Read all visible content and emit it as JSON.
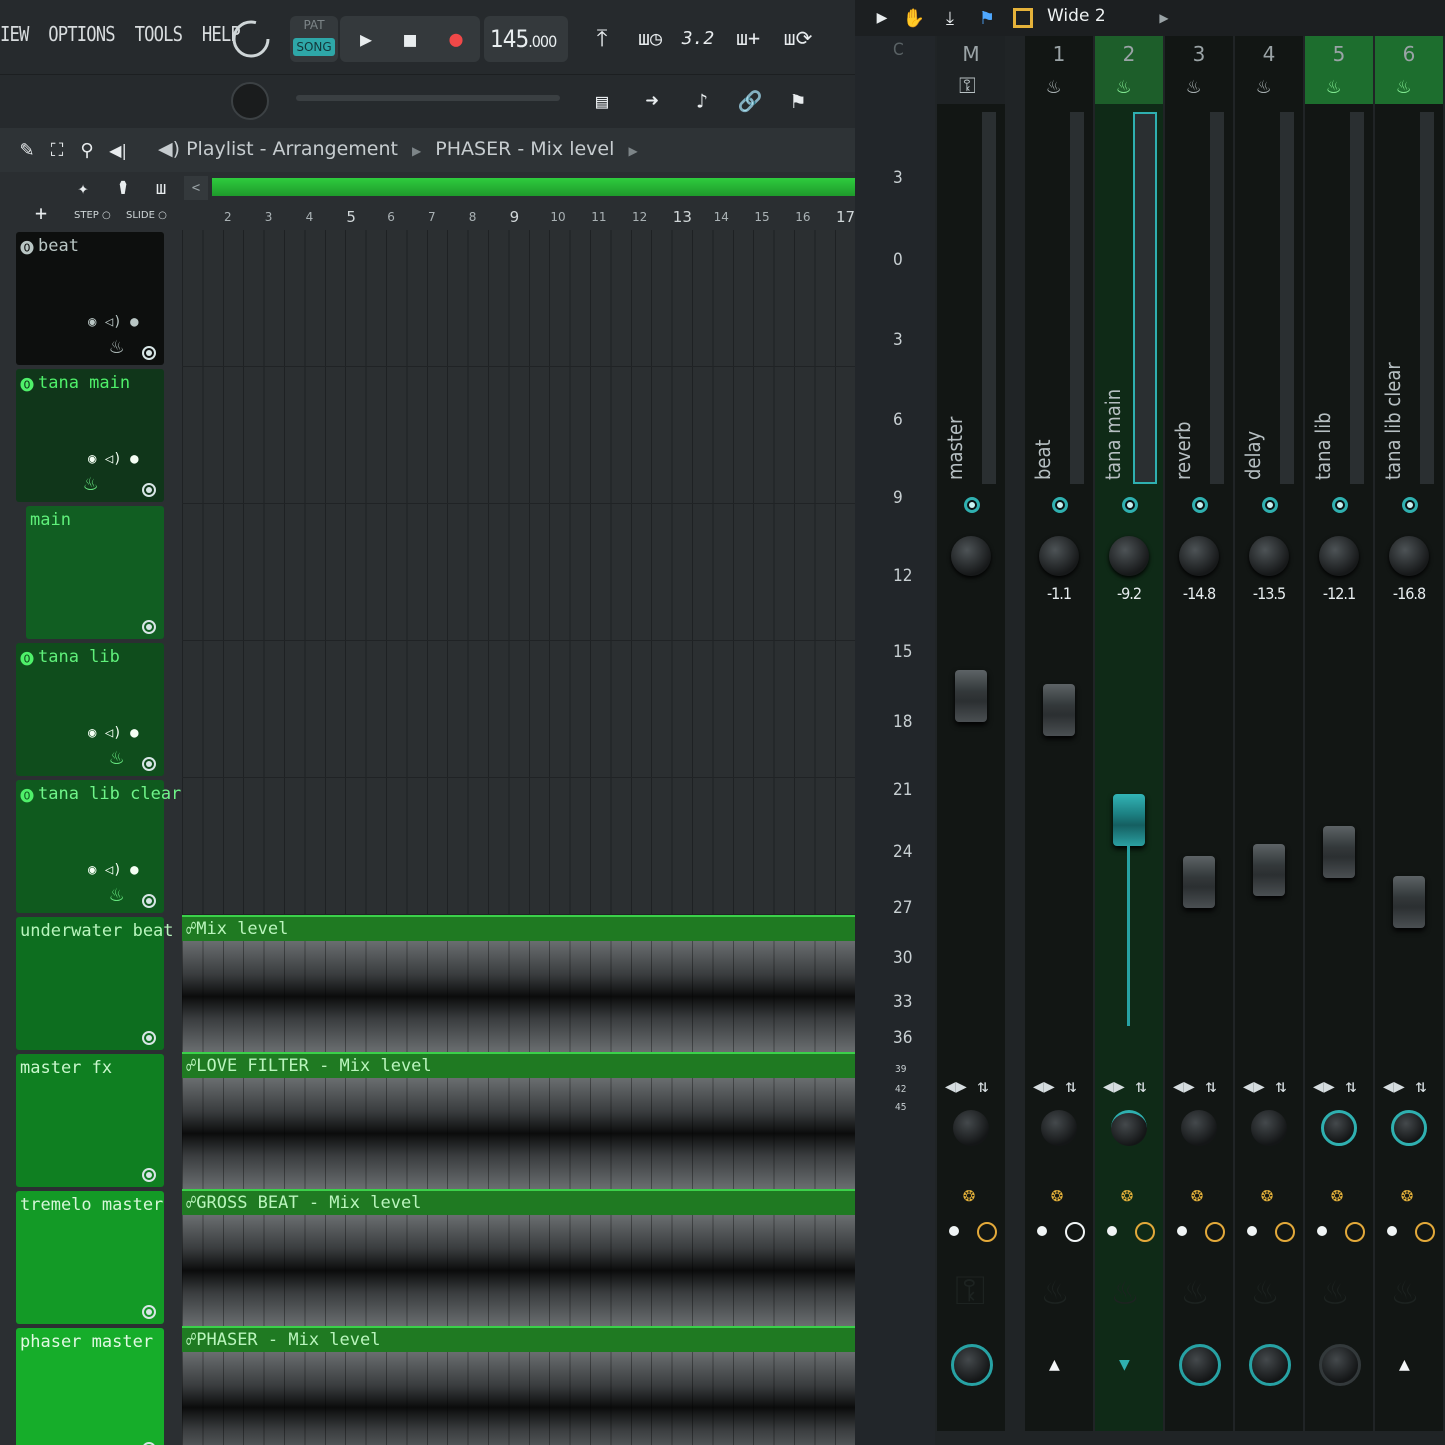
{
  "menu": [
    "IEW",
    "OPTIONS",
    "TOOLS",
    "HELP"
  ],
  "transport": {
    "pat_label": "PAT",
    "song_label": "SONG",
    "tempo_int": "145",
    "tempo_dec": ".000"
  },
  "breadcrumb": {
    "items": [
      "Playlist - Arrangement",
      "PHASER - Mix level"
    ]
  },
  "snap": {
    "step_label": "STEP",
    "slide_label": "SLIDE",
    "add_label": "+"
  },
  "ruler": [
    "2",
    "3",
    "4",
    "5",
    "6",
    "7",
    "8",
    "9",
    "10",
    "11",
    "12",
    "13",
    "14",
    "15",
    "16",
    "17"
  ],
  "tracks": [
    {
      "name": "beat",
      "auto": ""
    },
    {
      "name": "tana main",
      "auto": ""
    },
    {
      "name": "main",
      "auto": ""
    },
    {
      "name": "tana lib",
      "auto": ""
    },
    {
      "name": "tana lib clear",
      "auto": ""
    },
    {
      "name": "underwater beat",
      "auto": "Mix level"
    },
    {
      "name": "master fx",
      "auto": "LOVE FILTER - Mix level"
    },
    {
      "name": "tremelo master",
      "auto": "GROSS BEAT - Mix level"
    },
    {
      "name": "phaser master",
      "auto": "PHASER - Mix level"
    }
  ],
  "colors": {
    "accent": "#2fb0b0",
    "green": "#2ecc3e",
    "selected_strip": "#1d5e2a"
  },
  "mixer": {
    "preset": "Wide 2",
    "scale": [
      "C",
      "3",
      "0",
      "3",
      "6",
      "9",
      "12",
      "15",
      "18",
      "21",
      "24",
      "27",
      "30",
      "33",
      "36",
      "39",
      "42",
      "45"
    ],
    "strips": [
      {
        "num": "M",
        "label": "master",
        "value": ""
      },
      {
        "num": "1",
        "label": "beat",
        "value": "-1.1"
      },
      {
        "num": "2",
        "label": "tana main",
        "value": "-9.2"
      },
      {
        "num": "3",
        "label": "reverb",
        "value": "-14.8"
      },
      {
        "num": "4",
        "label": "delay",
        "value": "-13.5"
      },
      {
        "num": "5",
        "label": "tana lib",
        "value": "-12.1"
      },
      {
        "num": "6",
        "label": "tana lib clear",
        "value": "-16.8"
      }
    ]
  }
}
